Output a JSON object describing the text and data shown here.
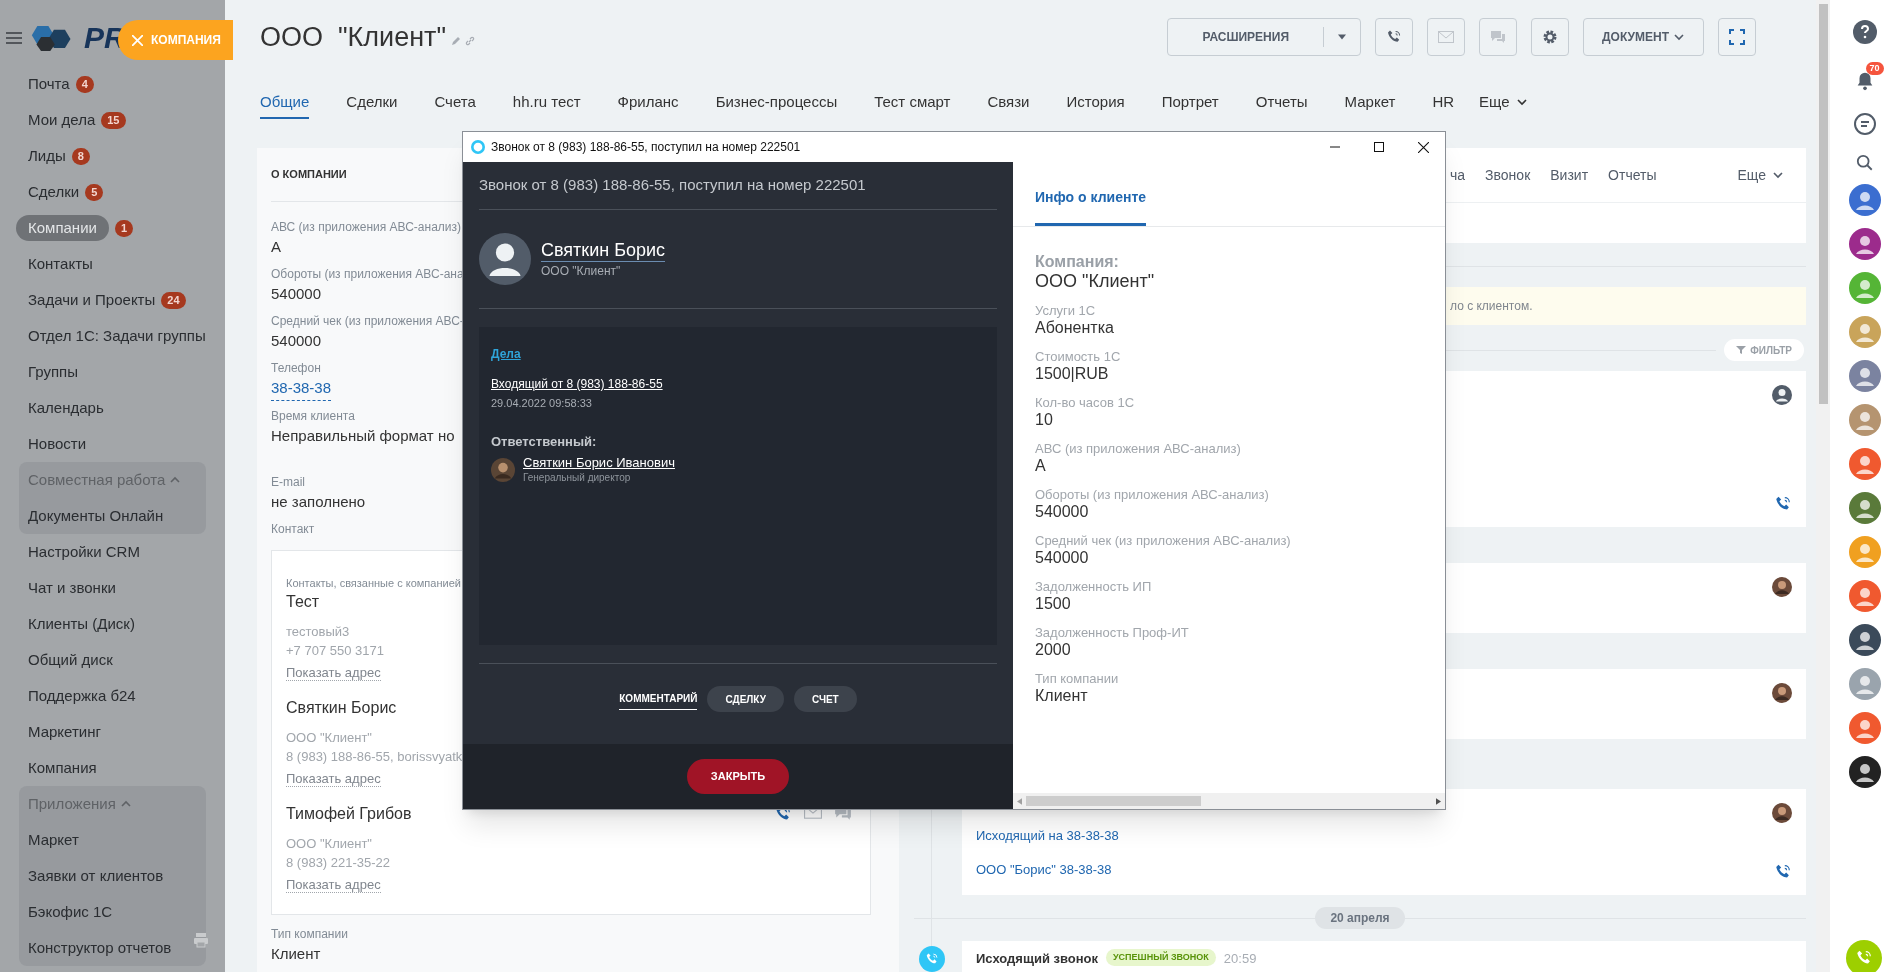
{
  "sidebar": {
    "logo_text": "PR",
    "items": [
      {
        "kind": "link",
        "label": "Почта",
        "counter": "4",
        "selected": false
      },
      {
        "kind": "link",
        "label": "Мои дела",
        "counter": "15",
        "selected": false
      },
      {
        "kind": "link",
        "label": "Лиды",
        "counter": "8",
        "selected": false
      },
      {
        "kind": "link",
        "label": "Сделки",
        "counter": "5",
        "selected": false
      },
      {
        "kind": "link",
        "label": "Компании",
        "counter": "1",
        "selected": true
      },
      {
        "kind": "link",
        "label": "Контакты",
        "selected": false
      },
      {
        "kind": "link",
        "label": "Задачи и Проекты",
        "counter": "24",
        "selected": false
      },
      {
        "kind": "link",
        "label": "Отдел 1С: Задачи группы",
        "selected": false
      },
      {
        "kind": "link",
        "label": "Группы",
        "selected": false
      },
      {
        "kind": "link",
        "label": "Календарь",
        "selected": false
      },
      {
        "kind": "link",
        "label": "Новости",
        "selected": false
      },
      {
        "kind": "group",
        "label": "Совместная работа",
        "expanded": true,
        "children": [
          {
            "label": "Документы Онлайн",
            "selected": false
          }
        ]
      },
      {
        "kind": "link",
        "label": "Настройки CRM",
        "selected": false
      },
      {
        "kind": "link",
        "label": "Чат и звонки",
        "selected": false
      },
      {
        "kind": "link",
        "label": "Клиенты (Диск)",
        "selected": false
      },
      {
        "kind": "link",
        "label": "Общий диск",
        "selected": false
      },
      {
        "kind": "link",
        "label": "Поддержка б24",
        "selected": false
      },
      {
        "kind": "link",
        "label": "Маркетинг",
        "selected": false
      },
      {
        "kind": "link",
        "label": "Компания",
        "selected": false
      },
      {
        "kind": "group",
        "label": "Приложения",
        "expanded": true,
        "children": [
          {
            "label": "Маркет",
            "selected": false
          },
          {
            "label": "Заявки от клиентов",
            "selected": false
          },
          {
            "label": "Бэкофис 1С",
            "selected": false
          },
          {
            "label": "Конструктор отчетов",
            "selected": false
          }
        ]
      }
    ]
  },
  "slider_label": "КОМПАНИЯ",
  "header": {
    "title": "ООО  \"Клиент\"",
    "extensions_button": "РАСШИРЕНИЯ",
    "document_button": "ДОКУМЕНТ"
  },
  "tabs": [
    {
      "label": "Общие",
      "selected": true
    },
    {
      "label": "Сделки",
      "selected": false
    },
    {
      "label": "Счета",
      "selected": false
    },
    {
      "label": "hh.ru тест",
      "selected": false
    },
    {
      "label": "Фриланс",
      "selected": false
    },
    {
      "label": "Бизнес-процессы",
      "selected": false
    },
    {
      "label": "Тест смарт",
      "selected": false
    },
    {
      "label": "Связи",
      "selected": false
    },
    {
      "label": "История",
      "selected": false
    },
    {
      "label": "Портрет",
      "selected": false
    },
    {
      "label": "Отчеты",
      "selected": false
    },
    {
      "label": "Маркет",
      "selected": false
    },
    {
      "label": "HR",
      "selected": false
    }
  ],
  "tabs_more": "Еще",
  "about": {
    "heading": "О КОМПАНИИ",
    "fields": [
      {
        "kind": "text",
        "label": "АВС (из приложения АВС-анализ)",
        "value": "А"
      },
      {
        "kind": "text",
        "label": "Обороты (из приложения АВС-ана",
        "value": "540000"
      },
      {
        "kind": "text",
        "label": "Средний чек (из приложения АВС-",
        "value": "540000"
      },
      {
        "kind": "link",
        "label": "Телефон",
        "value": "38-38-38"
      },
      {
        "kind": "text",
        "label": "Время клиента",
        "value": "Неправильный формат но"
      },
      {
        "kind": "text",
        "label": "E-mail",
        "value": "не заполнено"
      }
    ],
    "contact_label": "Контакт",
    "contacts_caption": "Контакты, связанные с компанией",
    "contacts": [
      {
        "name": "Тест",
        "lines": [
          "тестовый3",
          "+7 707 550 3171"
        ],
        "address_link": "Показать адрес",
        "actions": false
      },
      {
        "name": "Святкин Борис",
        "lines": [
          "ООО \"Клиент\"",
          "8 (983) 188-86-55, borissvyatk"
        ],
        "address_link": "Показать адрес",
        "actions": false
      },
      {
        "name": "Тимофей Грибов",
        "lines": [
          "ООО \"Клиент\"",
          "8 (983) 221-35-22"
        ],
        "address_link": "Показать адрес",
        "actions": true
      }
    ],
    "company_type": {
      "label": "Тип компании",
      "value": "Клиент"
    }
  },
  "timeline": {
    "tabs": [
      "ча",
      "Звонок",
      "Визит",
      "Отчеты"
    ],
    "more": "Еще",
    "notice": "ло с клиентом.",
    "filter": "ФИЛЬТР",
    "cards": [
      {
        "kind": "call"
      },
      {
        "kind": "note"
      },
      {
        "kind": "note"
      },
      {
        "kind": "call",
        "lines": [
          "Исходящий на 38-38-38",
          "ООО \"Борис\" 38-38-38"
        ]
      }
    ],
    "date": "20 апреля",
    "last": {
      "title": "Исходящий звонок",
      "badge": "УСПЕШНЫЙ ЗВОНОК",
      "time": "20:59"
    }
  },
  "dialog": {
    "window_title": "Звонок от 8 (983) 188-86-55, поступил на номер 222501",
    "heading": "Звонок от 8 (983) 188-86-55, поступил на номер 222501",
    "caller_name": "Святкин Борис",
    "caller_company": "ООО \"Клиент\"",
    "activities_link": "Дела",
    "activity_title": "Входящий от 8 (983) 188-86-55",
    "activity_time": "29.04.2022 09:58:33",
    "responsible_label": "Ответственный:",
    "responsible_name": "Святкин Борис Иванович",
    "responsible_position": "Генеральный директор",
    "actions": [
      {
        "label": "КОММЕНТАРИЙ",
        "selected": true
      },
      {
        "label": "СДЕЛКУ",
        "selected": false
      },
      {
        "label": "СЧЕТ",
        "selected": false
      }
    ],
    "close_button": "ЗАКРЫТЬ",
    "info_tab": "Инфо о клиенте",
    "company_label": "Компания:",
    "company_value": "ООО \"Клиент\"",
    "fields": [
      {
        "label": "Услуги 1С",
        "value": "Абонентка"
      },
      {
        "label": "Стоимость 1С",
        "value": "1500|RUB"
      },
      {
        "label": "Кол-во часов 1С",
        "value": "10"
      },
      {
        "label": "АВС (из приложения АВС-анализ)",
        "value": "А"
      },
      {
        "label": "Обороты (из приложения АВС-анализ)",
        "value": "540000"
      },
      {
        "label": "Средний чек (из приложения АВС-анализ)",
        "value": "540000"
      },
      {
        "label": "Задолженность ИП",
        "value": "1500"
      },
      {
        "label": "Задолженность Проф-ИТ",
        "value": "2000"
      },
      {
        "label": "Тип компании",
        "value": "Клиент"
      }
    ]
  },
  "right_bar": {
    "bell_badge": "70"
  }
}
